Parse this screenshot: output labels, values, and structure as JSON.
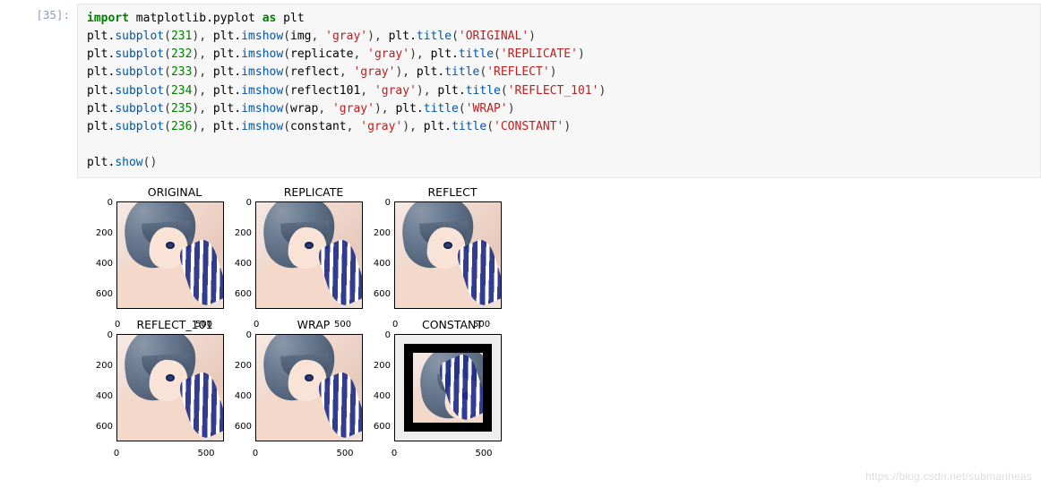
{
  "prompt": "[35]:",
  "code": {
    "l1": {
      "kw": "import",
      "mod": "matplotlib.pyplot",
      "as": "as",
      "alias": "plt"
    },
    "l2": {
      "pre": "plt.",
      "f1": "subplot",
      "a1": "231",
      "f2": "imshow",
      "arg2a": "img",
      "arg2b": "'gray'",
      "f3": "title",
      "arg3": "'ORIGINAL'"
    },
    "l3": {
      "pre": "plt.",
      "f1": "subplot",
      "a1": "232",
      "f2": "imshow",
      "arg2a": "replicate",
      "arg2b": "'gray'",
      "f3": "title",
      "arg3": "'REPLICATE'"
    },
    "l4": {
      "pre": "plt.",
      "f1": "subplot",
      "a1": "233",
      "f2": "imshow",
      "arg2a": "reflect",
      "arg2b": "'gray'",
      "f3": "title",
      "arg3": "'REFLECT'"
    },
    "l5": {
      "pre": "plt.",
      "f1": "subplot",
      "a1": "234",
      "f2": "imshow",
      "arg2a": "reflect101",
      "arg2b": "'gray'",
      "f3": "title",
      "arg3": "'REFLECT_101'"
    },
    "l6": {
      "pre": "plt.",
      "f1": "subplot",
      "a1": "235",
      "f2": "imshow",
      "arg2a": "wrap",
      "arg2b": "'gray'",
      "f3": "title",
      "arg3": "'WRAP'"
    },
    "l7": {
      "pre": "plt.",
      "f1": "subplot",
      "a1": "236",
      "f2": "imshow",
      "arg2a": "constant",
      "arg2b": "'gray'",
      "f3": "title",
      "arg3": "'CONSTANT'"
    },
    "l9": {
      "pre": "plt.",
      "f1": "show"
    }
  },
  "chart_data": [
    {
      "type": "table",
      "title": "ORIGINAL",
      "yticks": [
        "0",
        "200",
        "400",
        "600"
      ],
      "xticks": [
        "0",
        "500"
      ],
      "xlim": [
        0,
        600
      ],
      "ylim": [
        700,
        0
      ]
    },
    {
      "type": "table",
      "title": "REPLICATE",
      "yticks": [
        "0",
        "200",
        "400",
        "600"
      ],
      "xticks": [
        "0",
        "500"
      ],
      "xlim": [
        0,
        600
      ],
      "ylim": [
        700,
        0
      ]
    },
    {
      "type": "table",
      "title": "REFLECT",
      "yticks": [
        "0",
        "200",
        "400",
        "600"
      ],
      "xticks": [
        "0",
        "500"
      ],
      "xlim": [
        0,
        600
      ],
      "ylim": [
        700,
        0
      ]
    },
    {
      "type": "table",
      "title": "REFLECT_101",
      "yticks": [
        "0",
        "200",
        "400",
        "600"
      ],
      "xticks": [
        "0",
        "500"
      ],
      "xlim": [
        0,
        600
      ],
      "ylim": [
        700,
        0
      ]
    },
    {
      "type": "table",
      "title": "WRAP",
      "yticks": [
        "0",
        "200",
        "400",
        "600"
      ],
      "xticks": [
        "0",
        "500"
      ],
      "xlim": [
        0,
        600
      ],
      "ylim": [
        700,
        0
      ]
    },
    {
      "type": "table",
      "title": "CONSTANT",
      "yticks": [
        "0",
        "200",
        "400",
        "600"
      ],
      "xticks": [
        "0",
        "500"
      ],
      "xlim": [
        0,
        600
      ],
      "ylim": [
        700,
        0
      ]
    }
  ],
  "overlay": {
    "row1_xtick0": "0",
    "row1_xtick500": "500"
  },
  "yticks": {
    "t0": "0",
    "t200": "200",
    "t400": "400",
    "t600": "600"
  },
  "xticks": {
    "x0": "0",
    "x500": "500"
  },
  "watermark": "https://blog.csdn.net/submarineas"
}
